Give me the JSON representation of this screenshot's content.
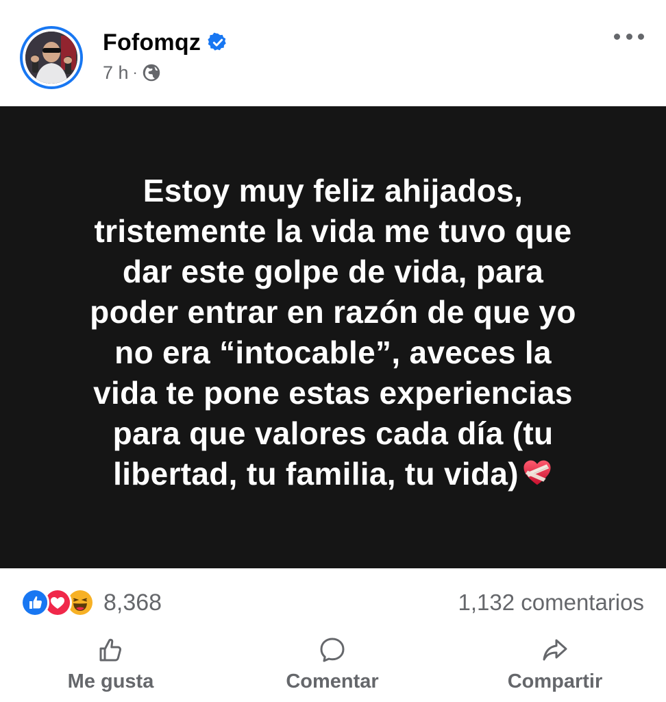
{
  "post": {
    "author": "Fofomqz",
    "verified": true,
    "time": "7 h",
    "separator": "·",
    "audience_icon": "globe-icon",
    "more_icon": "more-options-icon",
    "text": "Estoy muy feliz ahijados,\ntristemente la vida me tuvo que\ndar este golpe de vida, para\npoder entrar en razón de que yo\nno era “intocable”, aveces la\nvida te pone estas experiencias\npara que valores cada día (tu\nlibertad, tu familia, tu vida)",
    "text_emoji": "mending-heart-icon",
    "background_color": "#151515"
  },
  "stats": {
    "reaction_icons": [
      "like-icon",
      "love-icon",
      "haha-icon"
    ],
    "reaction_count": "8,368",
    "comments": "1,132 comentarios"
  },
  "actions": {
    "like": "Me gusta",
    "comment": "Comentar",
    "share": "Compartir"
  },
  "colors": {
    "accent": "#1877f2",
    "secondary_text": "#65676b",
    "love": "#f0284a",
    "haha": "#f7b125"
  }
}
